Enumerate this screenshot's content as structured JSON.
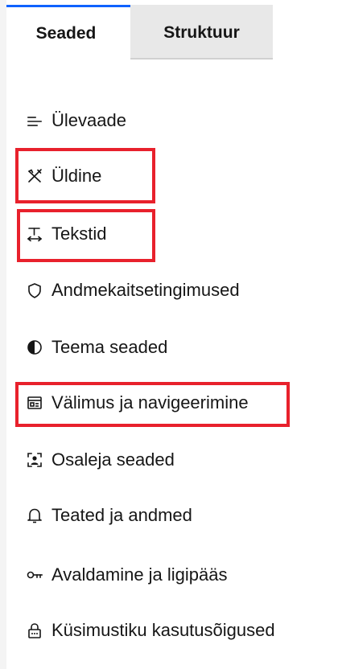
{
  "tabs": [
    {
      "label": "Seaded",
      "active": true
    },
    {
      "label": "Struktuur",
      "active": false
    }
  ],
  "menu": {
    "items": [
      {
        "label": "Ülevaade",
        "icon": "overview-icon"
      },
      {
        "label": "Üldine",
        "icon": "tools-icon"
      },
      {
        "label": "Tekstid",
        "icon": "text-icon"
      },
      {
        "label": "Andmekaitsetingimused",
        "icon": "shield-icon"
      },
      {
        "label": "Teema seaded",
        "icon": "contrast-icon"
      },
      {
        "label": "Välimus ja navigeerimine",
        "icon": "layout-icon"
      },
      {
        "label": "Osaleja seaded",
        "icon": "participant-icon"
      },
      {
        "label": "Teated ja andmed",
        "icon": "bell-icon"
      },
      {
        "label": "Avaldamine ja ligipääs",
        "icon": "key-icon"
      },
      {
        "label": "Küsimustiku kasutusõigused",
        "icon": "lock-icon"
      }
    ]
  },
  "colors": {
    "accent": "#0f62fe",
    "highlight": "#e8212c",
    "text": "#161616"
  }
}
